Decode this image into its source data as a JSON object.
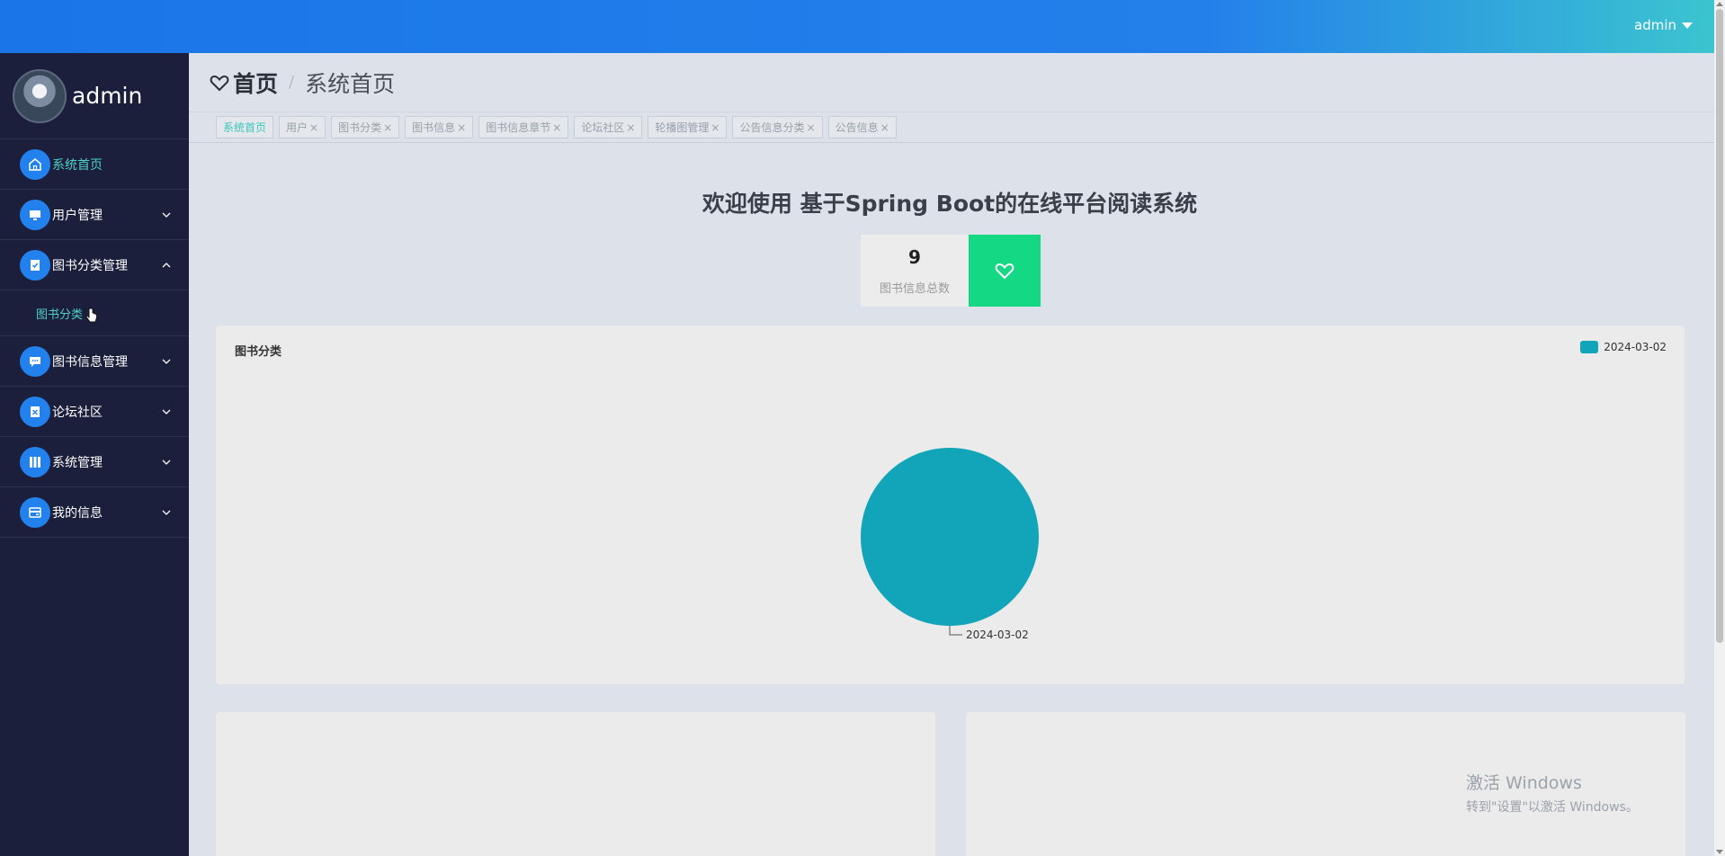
{
  "topbar": {
    "user_label": "admin"
  },
  "sidebar": {
    "profile_name": "admin",
    "items": [
      {
        "label": "系统首页",
        "icon": "home-icon",
        "active": true
      },
      {
        "label": "用户管理",
        "icon": "monitor-icon"
      },
      {
        "label": "图书分类管理",
        "icon": "clipboard-icon",
        "expanded": true
      },
      {
        "label": "图书信息管理",
        "icon": "chat-icon"
      },
      {
        "label": "论坛社区",
        "icon": "document-icon"
      },
      {
        "label": "系统管理",
        "icon": "book-icon"
      },
      {
        "label": "我的信息",
        "icon": "wallet-icon"
      }
    ],
    "sub_item": "图书分类"
  },
  "header": {
    "title": "首页",
    "separator": "/",
    "subtitle": "系统首页"
  },
  "tabs": [
    "系统首页",
    "用户",
    "图书分类",
    "图书信息",
    "图书信息章节",
    "论坛社区",
    "轮播图管理",
    "公告信息分类",
    "公告信息"
  ],
  "tab_close": "×",
  "welcome": "欢迎使用 基于Spring Boot的在线平台阅读系统",
  "stat": {
    "value": "9",
    "label": "图书信息总数"
  },
  "colors": {
    "accent": "#2281ec",
    "teal": "#12a4b8",
    "green": "#14d883",
    "sidebar": "#1b1f3b"
  },
  "chart_data": {
    "type": "pie",
    "title": "图书分类",
    "categories": [
      "2024-03-02"
    ],
    "values": [
      1
    ],
    "legend": [
      "2024-03-02"
    ],
    "legend_position": "top-right",
    "colors": [
      "#12a4b8"
    ]
  },
  "watermark": {
    "line1": "激活 Windows",
    "line2": "转到\"设置\"以激活 Windows。"
  }
}
